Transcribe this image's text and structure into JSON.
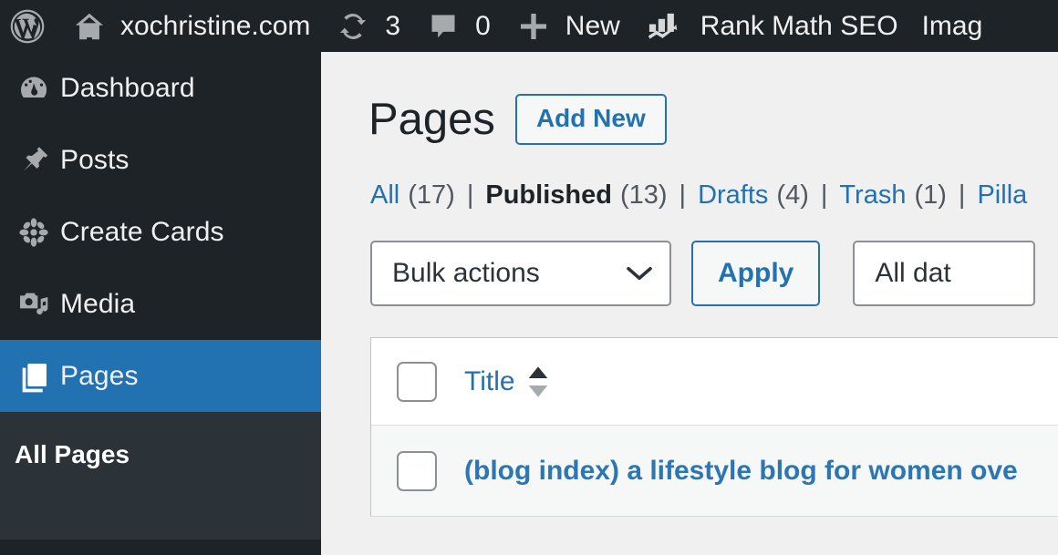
{
  "adminbar": {
    "logo_icon": "wordpress-logo-icon",
    "site_icon": "home-icon",
    "site_name": "xochristine.com",
    "updates_icon": "update-arrows-icon",
    "updates_count": "3",
    "comments_icon": "comment-bubble-icon",
    "comments_count": "0",
    "new_icon": "plus-icon",
    "new_label": "New",
    "rankmath_icon": "bar-chart-trend-icon",
    "rankmath_label": "Rank Math SEO",
    "truncated_label": "Imag"
  },
  "sidebar": {
    "items": [
      {
        "label": "Dashboard",
        "icon": "dashboard-gauge-icon",
        "current": false
      },
      {
        "label": "Posts",
        "icon": "pin-icon",
        "current": false
      },
      {
        "label": "Create Cards",
        "icon": "flower-icon",
        "current": false
      },
      {
        "label": "Media",
        "icon": "media-camera-music-icon",
        "current": false
      },
      {
        "label": "Pages",
        "icon": "pages-icon",
        "current": true
      }
    ],
    "submenu": [
      {
        "label": "All Pages",
        "current": true
      }
    ],
    "active_color": "#2271b1",
    "background_color": "#1d2327",
    "submenu_background_color": "#2c3338"
  },
  "main": {
    "title": "Pages",
    "add_new_label": "Add New",
    "filters": [
      {
        "label": "All",
        "count": "(17)",
        "current": false
      },
      {
        "label": "Published",
        "count": "(13)",
        "current": true
      },
      {
        "label": "Drafts",
        "count": "(4)",
        "current": false
      },
      {
        "label": "Trash",
        "count": "(1)",
        "current": false
      },
      {
        "label": "Pilla",
        "count": "",
        "current": false
      }
    ],
    "separator": "|",
    "toolbar": {
      "bulk_actions_value": "Bulk actions",
      "bulk_actions_icon": "chevron-down-icon",
      "apply_label": "Apply",
      "date_filter_value": "All dat"
    },
    "table": {
      "select_all_checkbox": "select-all-checkbox",
      "columns": [
        {
          "label": "Title",
          "sortable": true,
          "sort_icon": "sort-arrows-icon"
        }
      ],
      "rows": [
        {
          "checkbox": "row-checkbox",
          "title": "(blog index) a lifestyle blog for women ove"
        }
      ]
    }
  },
  "colors": {
    "link": "#2271b1",
    "text": "#1d2327",
    "muted": "#50575e",
    "page_background": "#f0f0f1"
  }
}
